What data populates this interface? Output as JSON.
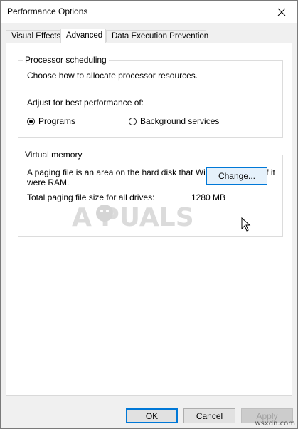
{
  "window": {
    "title": "Performance Options"
  },
  "icons": {
    "close": "close-icon",
    "cursor": "mouse-pointer-icon"
  },
  "tabs": [
    {
      "label": "Visual Effects",
      "active": false
    },
    {
      "label": "Advanced",
      "active": true
    },
    {
      "label": "Data Execution Prevention",
      "active": false
    }
  ],
  "processor": {
    "legend": "Processor scheduling",
    "description": "Choose how to allocate processor resources.",
    "adjust_label": "Adjust for best performance of:",
    "options": [
      {
        "label": "Programs",
        "checked": true
      },
      {
        "label": "Background services",
        "checked": false
      }
    ]
  },
  "virtual_memory": {
    "legend": "Virtual memory",
    "description_line1": "A paging file is an area on the hard disk that Windows uses as if it",
    "description_line2": "were RAM.",
    "total_label": "Total paging file size for all drives:",
    "total_value": "1280 MB",
    "change_label": "Change..."
  },
  "footer": {
    "ok_label": "OK",
    "cancel_label": "Cancel",
    "apply_label": "Apply",
    "apply_enabled": false
  },
  "watermarks": {
    "logo": "A  PUALS",
    "site": "wsxdn.com"
  },
  "colors": {
    "accent": "#0078d7",
    "window_bg": "#f0f0f0",
    "page_bg": "#ffffff"
  }
}
